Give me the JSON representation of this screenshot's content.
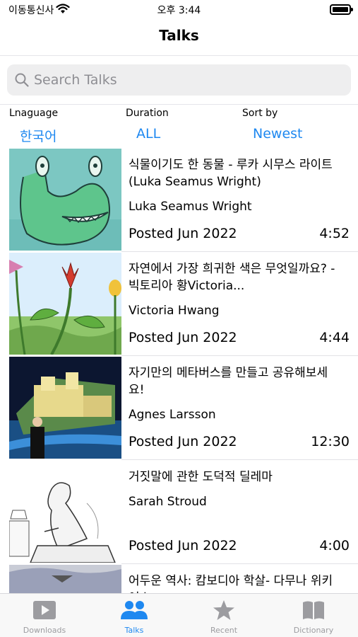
{
  "status": {
    "carrier": "이동통신사",
    "time": "오후 3:44"
  },
  "nav": {
    "title": "Talks"
  },
  "search": {
    "placeholder": "Search Talks"
  },
  "filters": [
    {
      "label": "Lnaguage",
      "value": "한국어"
    },
    {
      "label": "Duration",
      "value": "ALL"
    },
    {
      "label": "Sort by",
      "value": "Newest"
    }
  ],
  "talks": [
    {
      "title": "식물이기도 한 동물 - 루카 시무스 라이트(Luka Seamus Wright)",
      "speaker": "Luka Seamus Wright",
      "posted": "Posted Jun 2022",
      "duration": "4:52"
    },
    {
      "title": "자연에서 가장 희귀한 색은 무엇일까요? - 빅토리아 황Victoria...",
      "speaker": "Victoria Hwang",
      "posted": "Posted Jun 2022",
      "duration": "4:44"
    },
    {
      "title": "자기만의 메타버스를 만들고 공유해보세요!",
      "speaker": "Agnes Larsson",
      "posted": "Posted Jun 2022",
      "duration": "12:30"
    },
    {
      "title": "거짓말에 관한 도덕적 딜레마",
      "speaker": "Sarah Stroud",
      "posted": "Posted Jun 2022",
      "duration": "4:00"
    },
    {
      "title": "어두운 역사: 캄보디아 학살- 다무나 위키어스",
      "speaker": "",
      "posted": "",
      "duration": ""
    }
  ],
  "tabs": [
    {
      "label": "Downloads",
      "icon": "play-icon"
    },
    {
      "label": "Talks",
      "icon": "people-icon",
      "active": true
    },
    {
      "label": "Recent",
      "icon": "star-icon"
    },
    {
      "label": "Dictionary",
      "icon": "book-icon"
    }
  ],
  "colors": {
    "accent": "#1e88f0",
    "inactive": "#9c9ca0"
  }
}
